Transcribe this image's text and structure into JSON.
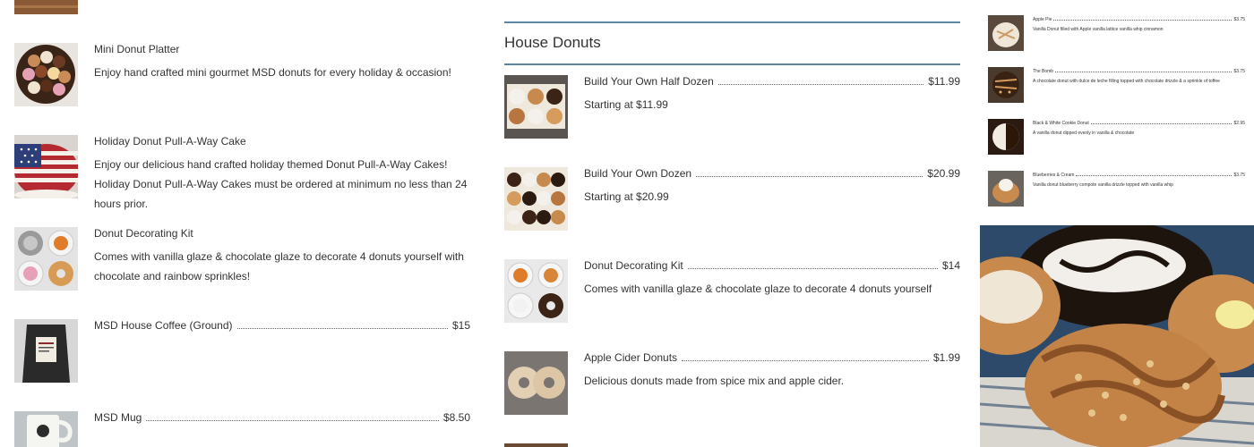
{
  "left_menu": {
    "items": [
      {
        "name": "Mini Donut Platter",
        "price": "",
        "description": "Enjoy hand crafted mini gourmet MSD donuts for every holiday & occasion!"
      },
      {
        "name": "Holiday Donut Pull-A-Way Cake",
        "price": "",
        "description": "Enjoy our delicious hand crafted holiday themed Donut Pull-A-Way Cakes! Holiday Donut Pull-A-Way Cakes must be ordered at minimum no less than 24 hours prior."
      },
      {
        "name": "Donut Decorating Kit",
        "price": "",
        "description": "Comes with vanilla glaze & chocolate glaze to decorate 4 donuts yourself with chocolate and rainbow sprinkles!"
      },
      {
        "name": "MSD House Coffee (Ground)",
        "price": "$15",
        "description": ""
      },
      {
        "name": "MSD Mug",
        "price": "$8.50",
        "description": ""
      }
    ]
  },
  "house_donuts": {
    "title": "House Donuts",
    "items": [
      {
        "name": "Build Your Own Half Dozen",
        "price": "$11.99",
        "description": "Starting at $11.99"
      },
      {
        "name": "Build Your Own Dozen",
        "price": "$20.99",
        "description": "Starting at $20.99"
      },
      {
        "name": "Donut Decorating Kit",
        "price": "$14",
        "description": "Comes with vanilla glaze & chocolate glaze to decorate 4 donuts yourself"
      },
      {
        "name": "Apple Cider Donuts",
        "price": "$1.99",
        "description": "Delicious donuts made from spice mix and apple cider."
      }
    ]
  },
  "right_menu": {
    "items": [
      {
        "name": "Apple Pie",
        "price": "$3.75",
        "description": "Vanilla Donut filled with Apple vanilla lattice vanilla whip cinnamon"
      },
      {
        "name": "The Bomb",
        "price": "$3.75",
        "description": "A chocolate donut with dulce de leche filling topped with chocolate drizzle & a sprinkle of toffee"
      },
      {
        "name": "Black & White Cookie Donut",
        "price": "$2.95",
        "description": "A vanilla donut dipped evenly in vanilla & chocolate"
      },
      {
        "name": "Blueberries & Cream",
        "price": "$3.75",
        "description": "Vanilla donut blueberry compote vanilla drizzle topped with vanilla whip"
      }
    ]
  },
  "colors": {
    "accent_rule": "#5c86a3",
    "text": "#333333",
    "background": "#ffffff"
  },
  "icons": {
    "thumbnails": [
      "donut-platter-photo",
      "flag-cake-photo",
      "decorating-kit-photo",
      "coffee-bag-photo",
      "mug-photo",
      "donut-box-photo",
      "donut-dozen-photo",
      "cider-donut-photo"
    ]
  }
}
